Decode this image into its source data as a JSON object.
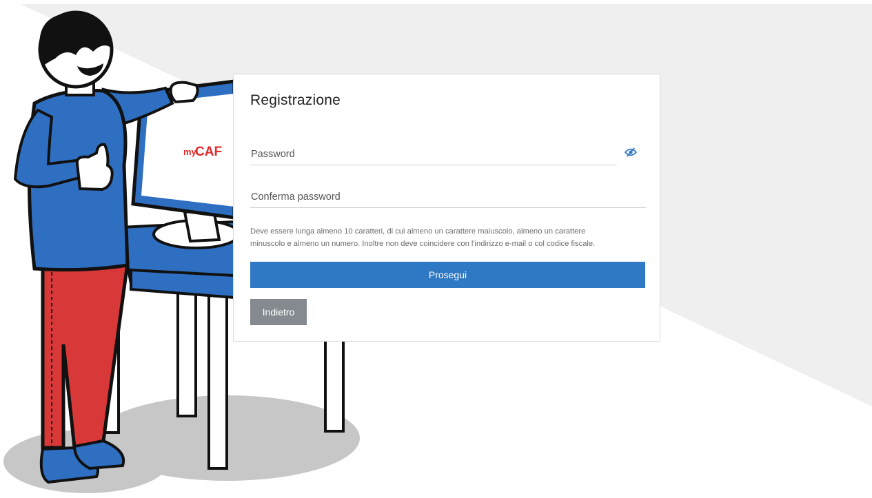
{
  "registration": {
    "title": "Registrazione",
    "password_placeholder": "Password",
    "password_value": "",
    "confirm_placeholder": "Conferma password",
    "confirm_value": "",
    "hint_line1": "Deve essere lunga almeno 10 caratteri, di cui almeno un carattere maiuscolo, almeno un carattere",
    "hint_line2": "minuscolo e almeno un numero. Inoltre non deve coincidere con l'indirizzo e-mail o col codice fiscale.",
    "continue_label": "Prosegui",
    "back_label": "Indietro"
  },
  "illustration": {
    "logo_text_small": "my",
    "logo_text_large": "CAF"
  },
  "icons": {
    "show_password": "eye-slash-icon"
  },
  "colors": {
    "primary": "#2f78c4",
    "secondary": "#858a90",
    "background_band": "#efefef",
    "logo_red": "#e32929",
    "shirt_blue": "#2f6fc2",
    "pants_red": "#d93838"
  }
}
